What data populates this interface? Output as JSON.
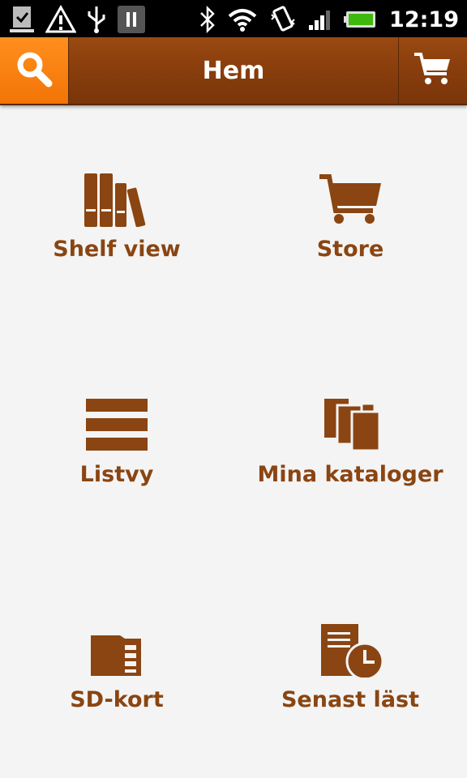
{
  "statusbar": {
    "time": "12:19",
    "left_icons": [
      "sync-download-icon",
      "warning-icon",
      "usb-icon",
      "pause-icon"
    ],
    "right_icons": [
      "bluetooth-icon",
      "wifi-icon",
      "vibrate-icon",
      "signal-icon",
      "battery-icon"
    ]
  },
  "actionbar": {
    "title": "Hem",
    "search_icon": "search-icon",
    "cart_icon": "cart-icon"
  },
  "menu": {
    "items": [
      {
        "label": "Shelf view",
        "icon": "books-icon"
      },
      {
        "label": "Store",
        "icon": "cart-icon"
      },
      {
        "label": "Listvy",
        "icon": "list-icon"
      },
      {
        "label": "Mina kataloger",
        "icon": "catalogs-icon"
      },
      {
        "label": "SD-kort",
        "icon": "sd-card-icon"
      },
      {
        "label": "Senast läst",
        "icon": "recent-document-icon"
      }
    ]
  },
  "colors": {
    "accent": "#8a4512",
    "actionbar": "#8a3e0c",
    "search_button": "#f27406",
    "background": "#f4f4f4"
  }
}
